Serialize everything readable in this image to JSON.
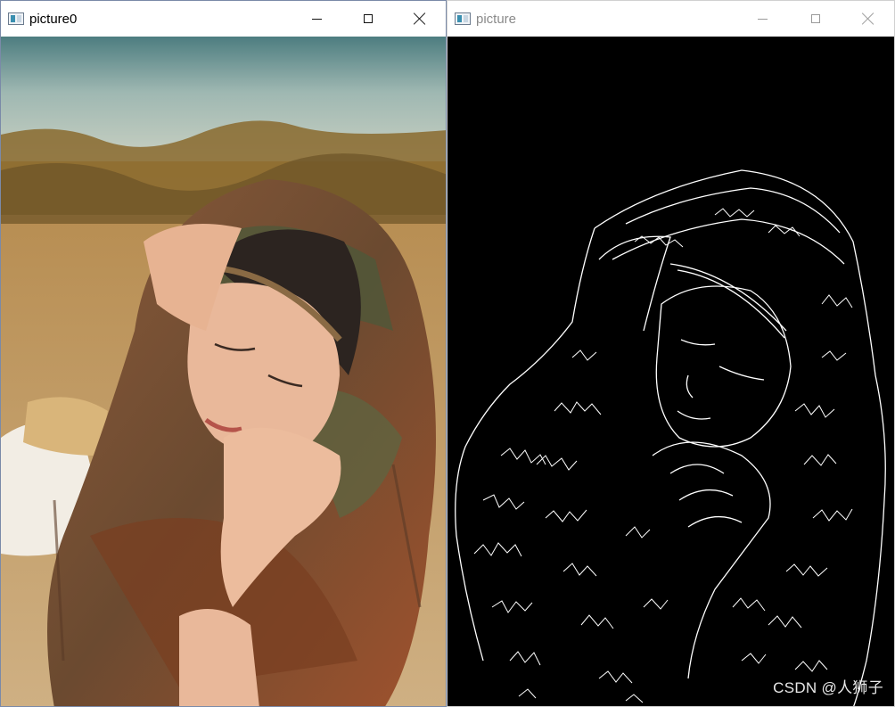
{
  "windows": [
    {
      "title": "picture0",
      "controls": {
        "minimize_icon": "minimize-icon",
        "maximize_icon": "maximize-icon",
        "close_icon": "close-icon"
      },
      "content": "photo"
    },
    {
      "title": "picture",
      "controls": {
        "minimize_icon": "minimize-icon",
        "maximize_icon": "maximize-icon",
        "close_icon": "close-icon"
      },
      "content": "edge-detection-image",
      "watermark": "CSDN @人狮子"
    }
  ],
  "colors": {
    "edge_background": "#000000",
    "edge_lines": "#ffffff",
    "inactive_title": "#8a8a8a"
  }
}
